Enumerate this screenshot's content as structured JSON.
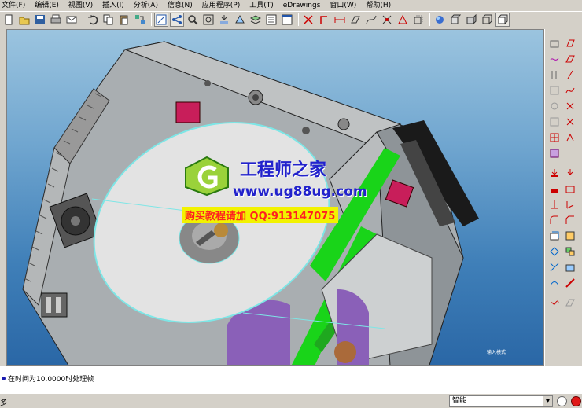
{
  "menu": {
    "items": [
      "文件(F)",
      "编辑(E)",
      "视图(V)",
      "插入(I)",
      "分析(A)",
      "信息(N)",
      "应用程序(P)",
      "工具(T)",
      "eDrawings",
      "窗口(W)",
      "帮助(H)"
    ]
  },
  "toolbar": {
    "icons": [
      "new-icon",
      "open-icon",
      "save-icon",
      "print-icon",
      "email-icon",
      "undo-icon",
      "copy-icon",
      "paste-icon",
      "regenerate-icon",
      "sketch-icon",
      "select-icon",
      "zoom-in-icon",
      "zoom-fit-icon",
      "repaint-icon",
      "orient-icon",
      "layer-icon",
      "model-tree-icon",
      "window-icon",
      "datum-plane-icon",
      "datum-axis-icon",
      "dimension-icon",
      "coordinate-icon",
      "curve-icon",
      "spin-center-icon",
      "wireframe-icon",
      "hidden-line-icon",
      "no-hidden-icon",
      "shading-icon"
    ]
  },
  "watermark": {
    "site_name": "工程师之家",
    "url": "www.ug88ug.com",
    "contact": "购买教程请加 QQ:913147075"
  },
  "viewport": {
    "corner_label": "输入模式"
  },
  "message": {
    "text": "在时间为10.0000时处理帧"
  },
  "status": {
    "left_text": "多",
    "filter_value": "智能"
  }
}
